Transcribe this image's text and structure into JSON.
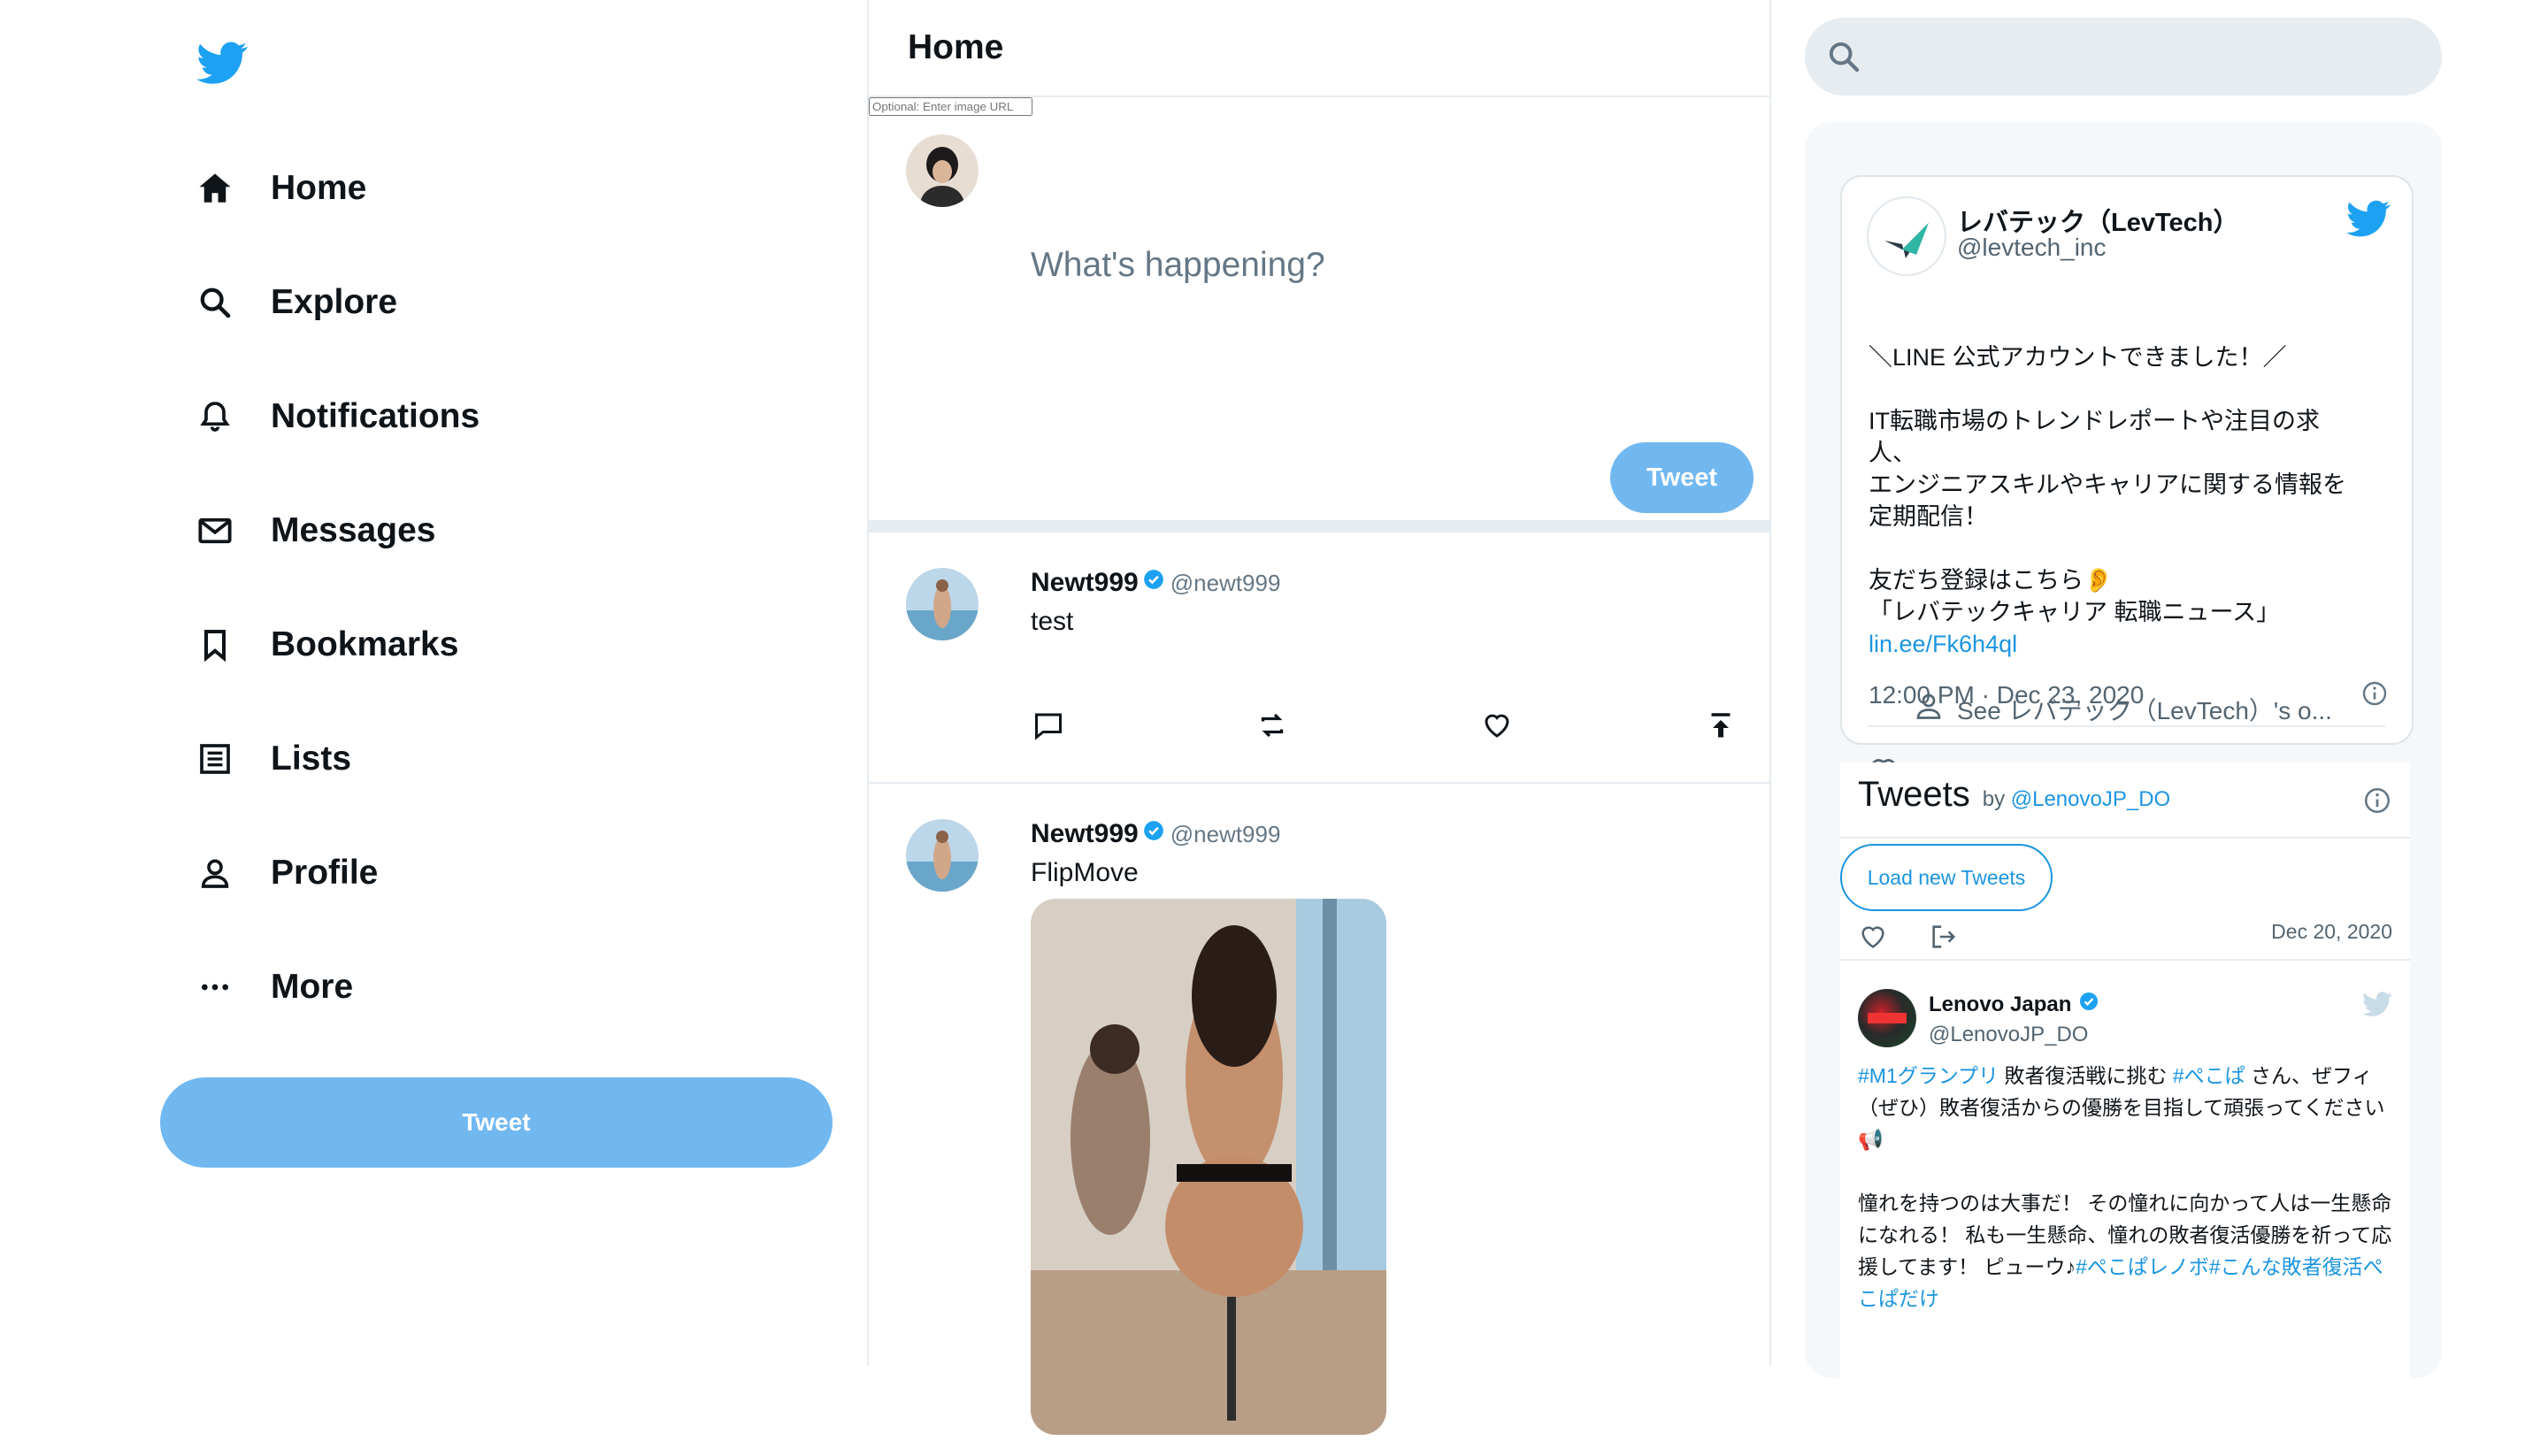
{
  "colors": {
    "accent": "#1da1f2",
    "button": "#71b8f1",
    "border": "#e6ecf0"
  },
  "sidebar": {
    "logo_icon": "twitter-bird-icon",
    "items": [
      {
        "label": "Home",
        "icon": "home-icon"
      },
      {
        "label": "Explore",
        "icon": "search-icon"
      },
      {
        "label": "Notifications",
        "icon": "bell-icon"
      },
      {
        "label": "Messages",
        "icon": "mail-icon"
      },
      {
        "label": "Bookmarks",
        "icon": "bookmark-icon"
      },
      {
        "label": "Lists",
        "icon": "list-icon"
      },
      {
        "label": "Profile",
        "icon": "user-icon"
      },
      {
        "label": "More",
        "icon": "more-icon"
      }
    ],
    "tweet_button": "Tweet"
  },
  "main": {
    "title": "Home",
    "compose": {
      "placeholder": "What's happening?",
      "image_url_placeholder": "Optional: Enter image URL",
      "tweet_button": "Tweet"
    },
    "tweets": [
      {
        "name": "Newt999",
        "handle": "@newt999",
        "text": "test"
      },
      {
        "name": "Newt999",
        "handle": "@newt999",
        "text": "FlipMove"
      }
    ]
  },
  "right": {
    "search": {
      "placeholder": ""
    },
    "embed": {
      "name": "レバテック（LevTech）",
      "handle": "@levtech_inc",
      "lines": [
        "＼LINE 公式アカウントできました！／",
        "",
        "IT転職市場のトレンドレポートや注目の求",
        "人、",
        "エンジニアスキルやキャリアに関する情報を",
        "定期配信！",
        "",
        "友だち登録はこちら👂",
        "「レバテックキャリア 転職ニュース」"
      ],
      "link": "lin.ee/Fk6h4ql",
      "time": "12:00 PM · Dec 23, 2020",
      "see_more": "See レバテック（LevTech）'s o..."
    },
    "timeline": {
      "title": "Tweets",
      "by": "by",
      "by_handle": "@LenovoJP_DO",
      "load_button": "Load new Tweets",
      "date": "Dec 20, 2020",
      "tweet": {
        "name": "Lenovo Japan",
        "handle": "@LenovoJP_DO",
        "p1_a": "#M1グランプリ",
        "p1_b": " 敗者復活戦に挑む ",
        "p1_c": "#ぺこぱ",
        "p1_d": " さん、ぜフィ（ぜひ）敗者復活からの優勝を目指して頑張ってください📢",
        "p2_a": "憧れを持つのは大事だ！ その憧れに向かって人は一生懸命になれる！ 私も一生懸命、憧れの敗者復活優勝を祈って応援してます！ ピューウ♪",
        "p2_b": "#ぺこぱレノボ#こんな敗者復活ぺこぱだけ"
      }
    }
  }
}
